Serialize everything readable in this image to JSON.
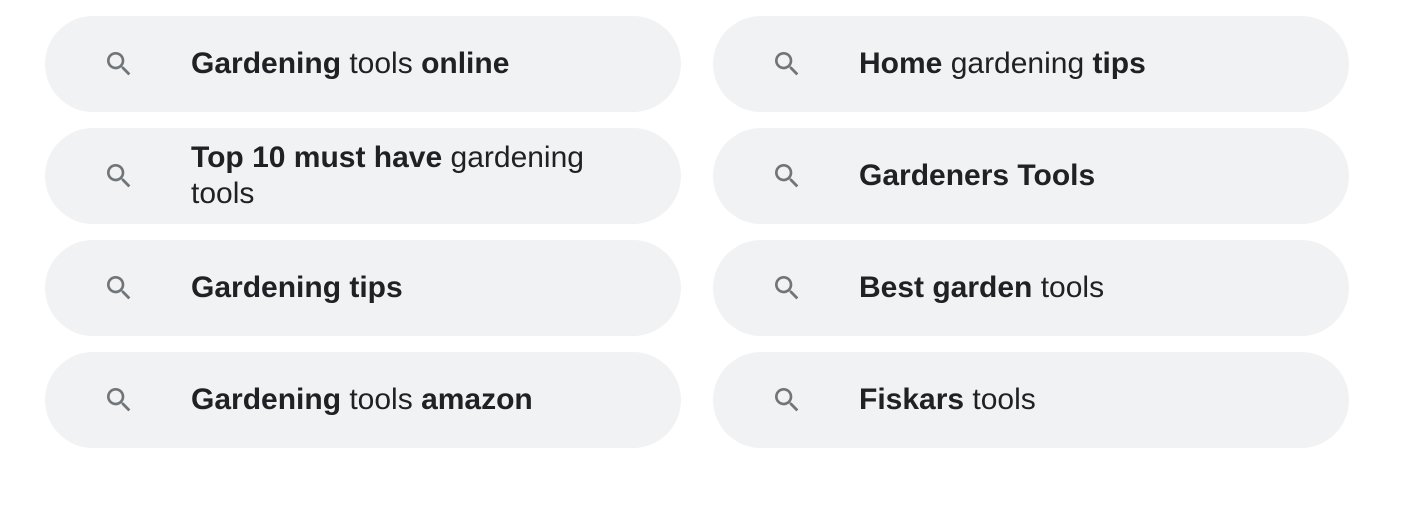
{
  "related_searches": [
    {
      "icon": "search-icon",
      "parts": [
        {
          "text": "Gardening",
          "bold": true
        },
        {
          "text": " tools ",
          "bold": false
        },
        {
          "text": "online",
          "bold": true
        }
      ]
    },
    {
      "icon": "search-icon",
      "parts": [
        {
          "text": "Home",
          "bold": true
        },
        {
          "text": " gardening ",
          "bold": false
        },
        {
          "text": "tips",
          "bold": true
        }
      ]
    },
    {
      "icon": "search-icon",
      "parts": [
        {
          "text": "Top 10 must have",
          "bold": true
        },
        {
          "text": " gardening tools",
          "bold": false
        }
      ]
    },
    {
      "icon": "search-icon",
      "parts": [
        {
          "text": "Gardeners Tools",
          "bold": true
        }
      ]
    },
    {
      "icon": "search-icon",
      "parts": [
        {
          "text": "Gardening tips",
          "bold": true
        }
      ]
    },
    {
      "icon": "search-icon",
      "parts": [
        {
          "text": "Best garden",
          "bold": true
        },
        {
          "text": " tools",
          "bold": false
        }
      ]
    },
    {
      "icon": "search-icon",
      "parts": [
        {
          "text": "Gardening",
          "bold": true
        },
        {
          "text": " tools ",
          "bold": false
        },
        {
          "text": "amazon",
          "bold": true
        }
      ]
    },
    {
      "icon": "search-icon",
      "parts": [
        {
          "text": "Fiskars",
          "bold": true
        },
        {
          "text": " tools",
          "bold": false
        }
      ]
    }
  ],
  "colors": {
    "chip_background": "#f1f2f4",
    "text": "#202124",
    "icon": "#70757a"
  }
}
